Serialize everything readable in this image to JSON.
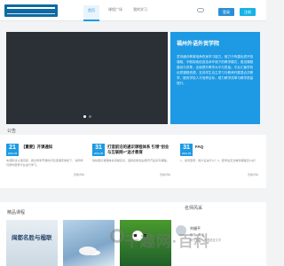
{
  "nav": {
    "logo_alt": "学院标识",
    "tabs": [
      "首页",
      "课程广场",
      "我的学习"
    ],
    "register": "注册",
    "login": "登录"
  },
  "hero": {
    "panel_title": "福州外语外贸学院",
    "panel_text": "坚持通识教育培养终身学习能力，致力于构建优质开放课程，不断探索信息技术环境下的教学模式，推进课程建设与改革，全面提升教学水平与质量。平台汇聚学校优质课程资源，支持学生自主学习与教师开展混合式教学，服务学校人才培养目标，助力教学改革与教学质量提升。"
  },
  "notices": {
    "section_title": "公告",
    "items": [
      {
        "day": "21",
        "ym": "2019-06",
        "title": "【重要】开课通知",
        "desc": "本通知请认真阅读，各位同学开课时间及选课安排如下，请同学们按时登录平台进行学习。",
        "more": "查看详情"
      },
      {
        "day": "31",
        "ym": "2019-05",
        "title": "打造前沿的通识课程体系 引领“创业与互联网+”送才教育",
        "desc": "我校通识课程体系持续完善，围绕创新创业教育开设系列课程。",
        "more": "查看详情"
      },
      {
        "day": "31",
        "ym": "2019-05",
        "title": "FAQ",
        "desc": "1、如何登录，用户名是什么？2、登录后无法看到课程怎么办？",
        "more": "查看详情"
      }
    ]
  },
  "courses": {
    "section_title": "精品课程",
    "items": [
      {
        "cover_text": "闽都名胜与楹联"
      },
      {
        "cover_text": ""
      },
      {
        "cover_text": ""
      }
    ]
  },
  "teachers": {
    "section_title": "名师风采",
    "items": [
      {
        "name": "刘福平",
        "line1": "职称：教授",
        "line2": "研究方向：外国语言文学"
      }
    ]
  },
  "watermark": {
    "text": "千趣网·百科"
  },
  "colors": {
    "accent": "#1d9ae3",
    "login": "#2b8fd8",
    "register": "#16b3e6"
  }
}
